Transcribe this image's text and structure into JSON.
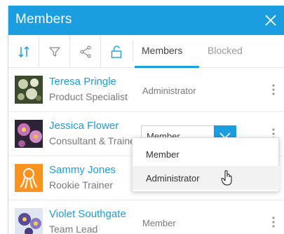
{
  "header": {
    "title": "Members"
  },
  "toolbar": {
    "icons": [
      "sort-icon",
      "filter-icon",
      "share-icon",
      "unlock-icon"
    ],
    "tabs": [
      {
        "label": "Members",
        "active": true
      },
      {
        "label": "Blocked",
        "active": false
      }
    ]
  },
  "members": [
    {
      "name": "Teresa Pringle",
      "title": "Product Specialist",
      "role": "Administrator"
    },
    {
      "name": "Jessica Flower",
      "title": "Consultant & Trainer",
      "role": "Member"
    },
    {
      "name": "Sammy Jones",
      "title": "Rookie Trainer",
      "role": ""
    },
    {
      "name": "Violet Southgate",
      "title": "Team Lead",
      "role": "Member"
    }
  ],
  "role_dropdown": {
    "selected": "Member",
    "options": [
      "Member",
      "Administrator"
    ],
    "hovered": "Administrator"
  },
  "colors": {
    "accent": "#1a9ee0",
    "avatar_orange": "#f7931e"
  }
}
